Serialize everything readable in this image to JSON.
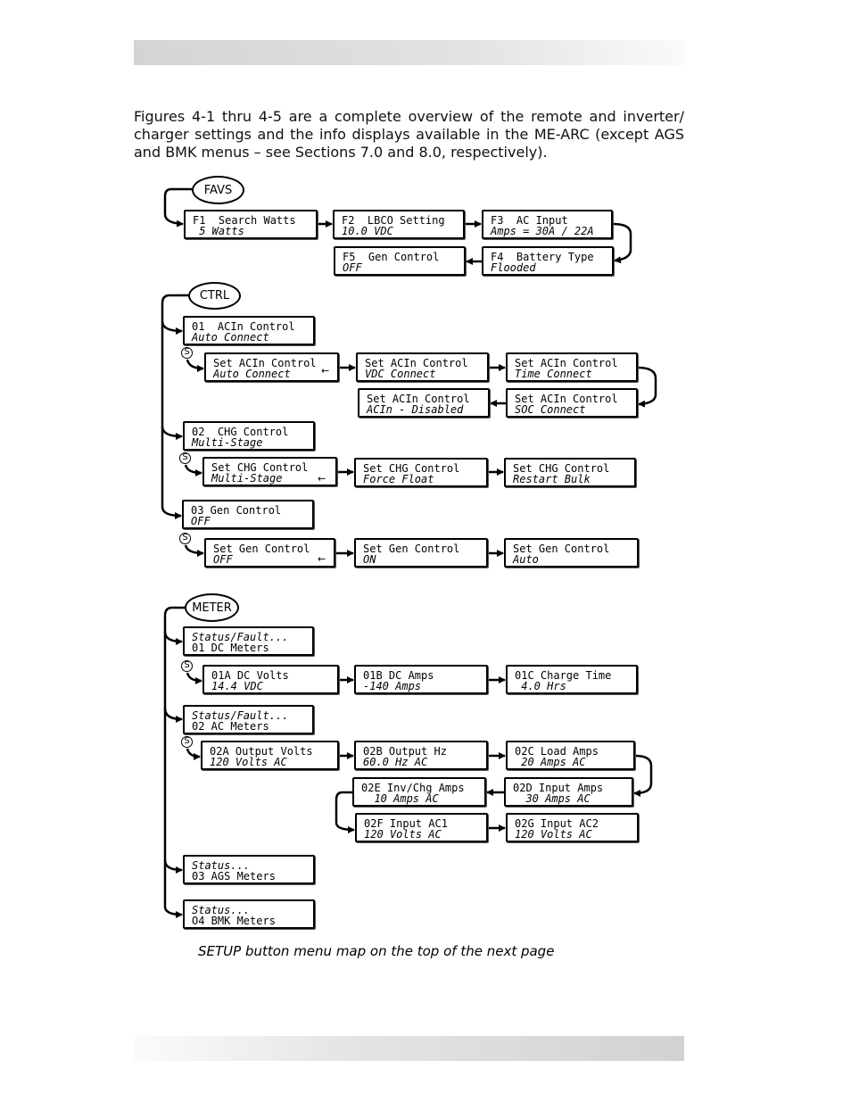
{
  "intro": "Figures 4-1 thru 4-5 are a complete overview of the remote and inverter/ charger settings and the info displays available in the ME-ARC (except AGS and BMK menus – see Sections 7.0 and 8.0, respectively).",
  "ovals": {
    "favs": "FAVS",
    "ctrl": "CTRL",
    "meter": "METER"
  },
  "s_label": "S",
  "back_arrow": "←",
  "boxes": {
    "f1": {
      "line1": "F1  Search Watts",
      "line2": " 5 Watts"
    },
    "f2": {
      "line1": "F2  LBCO Setting",
      "line2": "10.0 VDC"
    },
    "f3": {
      "line1": "F3  AC Input",
      "line2": "Amps = 30A / 22A"
    },
    "f4": {
      "line1": "F4  Battery Type",
      "line2": "Flooded"
    },
    "f5": {
      "line1": "F5  Gen Control",
      "line2": "OFF"
    },
    "c01": {
      "line1": "01  ACIn Control",
      "line2": "Auto Connect"
    },
    "acin1": {
      "line1": "Set ACIn Control",
      "line2": "Auto Connect"
    },
    "acin2": {
      "line1": "Set ACIn Control",
      "line2": "VDC Connect"
    },
    "acin3": {
      "line1": "Set ACIn Control",
      "line2": "Time Connect"
    },
    "acin4": {
      "line1": "Set ACIn Control",
      "line2": "SOC Connect"
    },
    "acin5": {
      "line1": "Set ACIn Control",
      "line2": "ACIn - Disabled"
    },
    "c02": {
      "line1": "02  CHG Control",
      "line2": "Multi-Stage"
    },
    "chg1": {
      "line1": "Set CHG Control",
      "line2": "Multi-Stage"
    },
    "chg2": {
      "line1": "Set CHG Control",
      "line2": "Force Float"
    },
    "chg3": {
      "line1": "Set CHG Control",
      "line2": "Restart Bulk"
    },
    "c03": {
      "line1": "03 Gen Control",
      "line2": "OFF"
    },
    "gen1": {
      "line1": "Set Gen Control",
      "line2": "OFF"
    },
    "gen2": {
      "line1": "Set Gen Control",
      "line2": "ON"
    },
    "gen3": {
      "line1": "Set Gen Control",
      "line2": "Auto"
    },
    "m01": {
      "line1": "Status/Fault...",
      "line2": "01 DC Meters"
    },
    "m01a": {
      "line1": "01A DC Volts",
      "line2": "14.4 VDC"
    },
    "m01b": {
      "line1": "01B DC Amps",
      "line2": "-140 Amps"
    },
    "m01c": {
      "line1": "01C Charge Time",
      "line2": " 4.0 Hrs"
    },
    "m02": {
      "line1": "Status/Fault...",
      "line2": "02 AC Meters"
    },
    "m02a": {
      "line1": "02A Output Volts",
      "line2": "120 Volts AC"
    },
    "m02b": {
      "line1": "02B Output Hz",
      "line2": "60.0 Hz AC"
    },
    "m02c": {
      "line1": "02C Load Amps",
      "line2": " 20 Amps AC"
    },
    "m02d": {
      "line1": "02D Input Amps",
      "line2": "  30 Amps AC"
    },
    "m02e": {
      "line1": "02E Inv/Chg Amps",
      "line2": "  10 Amps AC"
    },
    "m02f": {
      "line1": "02F Input AC1",
      "line2": "120 Volts AC"
    },
    "m02g": {
      "line1": "02G Input AC2",
      "line2": "120 Volts AC"
    },
    "m03": {
      "line1": "Status...",
      "line2": "03 AGS Meters"
    },
    "m04": {
      "line1": "Status...",
      "line2": "O4 BMK Meters"
    }
  },
  "caption": "SETUP button menu map on the top of the next page"
}
